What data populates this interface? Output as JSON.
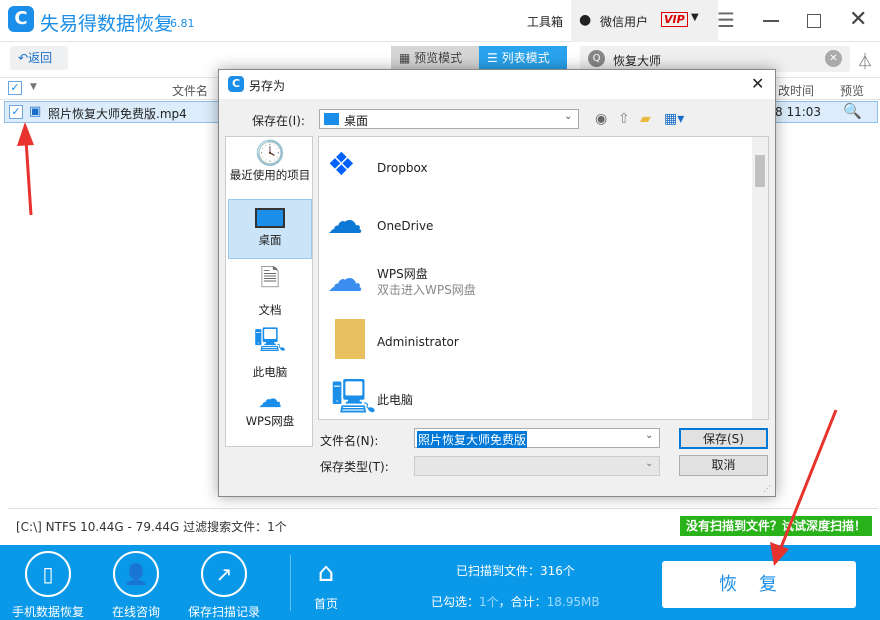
{
  "app": {
    "title": "失易得数据恢复",
    "version": "6.81",
    "toolbox": "工具箱",
    "user": "微信用户",
    "vip": "VIP"
  },
  "toolbar": {
    "back": "返回",
    "preview_mode": "预览模式",
    "list_mode": "列表模式",
    "search_value": "恢复大师"
  },
  "table": {
    "col_name": "文件名",
    "col_time": "改时间",
    "col_preview": "预览",
    "rows": [
      {
        "name": "照片恢复大师免费版.mp4",
        "time": "8  11:03"
      }
    ]
  },
  "status": {
    "text": "[C:\\] NTFS 10.44G - 79.44G 过滤搜索文件：1个",
    "deep_scan": "没有扫描到文件？试试深度扫描！"
  },
  "bottom": {
    "phone": "手机数据恢复",
    "consult": "在线咨询",
    "save_record": "保存扫描记录",
    "home": "首页",
    "scanned_label": "已扫描到文件：316个",
    "selected_label": "已勾选：",
    "selected_count": "1个",
    "total_label": "，合计：",
    "total_size": "18.95MB",
    "restore": "恢复"
  },
  "dialog": {
    "title": "另存为",
    "save_in_label": "保存在(I):",
    "save_in_value": "桌面",
    "places": [
      "最近使用的项目",
      "桌面",
      "文档",
      "此电脑",
      "WPS网盘"
    ],
    "files": [
      {
        "name": "Dropbox",
        "sub": ""
      },
      {
        "name": "OneDrive",
        "sub": ""
      },
      {
        "name": "WPS网盘",
        "sub": "双击进入WPS网盘"
      },
      {
        "name": "Administrator",
        "sub": ""
      },
      {
        "name": "此电脑",
        "sub": ""
      }
    ],
    "filename_label": "文件名(N):",
    "filename_value": "照片恢复大师免费版",
    "filetype_label": "保存类型(T):",
    "save": "保存(S)",
    "cancel": "取消"
  }
}
